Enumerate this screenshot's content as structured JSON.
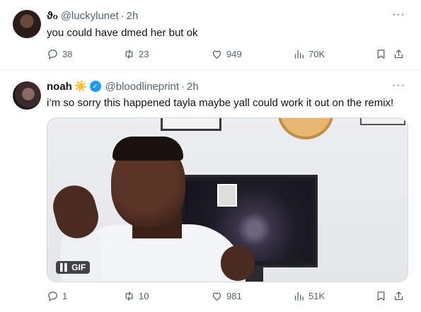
{
  "tweets": [
    {
      "display_name": "ϑℴ",
      "handle": "@luckylunet",
      "time": "2h",
      "text": "you could have dmed her but ok",
      "stats": {
        "replies": "38",
        "reposts": "23",
        "likes": "949",
        "views": "70K"
      }
    },
    {
      "display_name": "noah",
      "emoji": "☀️",
      "verified": true,
      "handle": "@bloodlineprint",
      "time": "2h",
      "text": "i’m so sorry this happened tayla maybe yall could work it out on the remix!",
      "media": {
        "type": "gif",
        "badge": "GIF"
      },
      "stats": {
        "replies": "1",
        "reposts": "10",
        "likes": "981",
        "views": "51K"
      }
    }
  ],
  "ui": {
    "separator": "·",
    "more": "···"
  },
  "colors": {
    "muted": "#536471",
    "accent": "#1d9bf0",
    "text": "#0f1419"
  },
  "icons": [
    "reply-icon",
    "repost-icon",
    "like-icon",
    "views-icon",
    "bookmark-icon",
    "share-icon",
    "verified-icon",
    "more-icon",
    "pause-icon"
  ]
}
